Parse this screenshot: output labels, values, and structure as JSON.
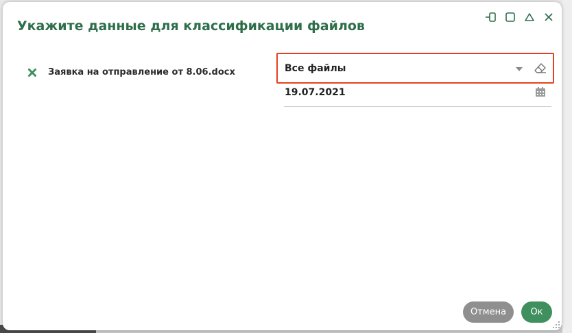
{
  "dialog": {
    "title": "Укажите данные для классификации файлов"
  },
  "window_controls": [
    {
      "name": "dock-icon"
    },
    {
      "name": "maximize-icon"
    },
    {
      "name": "collapse-icon"
    },
    {
      "name": "close-icon"
    }
  ],
  "file": {
    "name": "Заявка на отправление от 8.06.docx",
    "status_icon": "x-icon",
    "status_color": "#3f8f5f"
  },
  "classification_select": {
    "value": "Все файлы"
  },
  "date_field": {
    "value": "19.07.2021"
  },
  "buttons": {
    "cancel_label": "Отмена",
    "ok_label": "Ок"
  },
  "colors": {
    "accent": "#2e6e4b",
    "ok_button": "#3f8f5f",
    "cancel_button": "#8f8f8f",
    "highlight_border": "#e8401e"
  }
}
